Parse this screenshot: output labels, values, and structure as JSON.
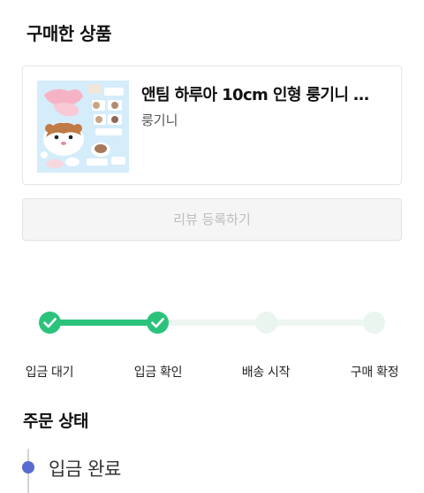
{
  "purchased": {
    "title": "구매한 상품",
    "product": {
      "name": "앤팀 하루아 10cm 인형 룽기니 …",
      "option": "룽기니"
    },
    "review_button_label": "리뷰 등록하기"
  },
  "progress": {
    "steps": [
      {
        "label": "입금 대기",
        "done": true
      },
      {
        "label": "입금 확인",
        "done": true
      },
      {
        "label": "배송 시작",
        "done": false
      },
      {
        "label": "구매 확정",
        "done": false
      }
    ]
  },
  "order_status": {
    "title": "주문 상태",
    "current": "입금 완료"
  },
  "colors": {
    "accent_green": "#2bc37c",
    "timeline_dot": "#5b6bd0"
  },
  "icons": {
    "step_done": "check-icon"
  }
}
